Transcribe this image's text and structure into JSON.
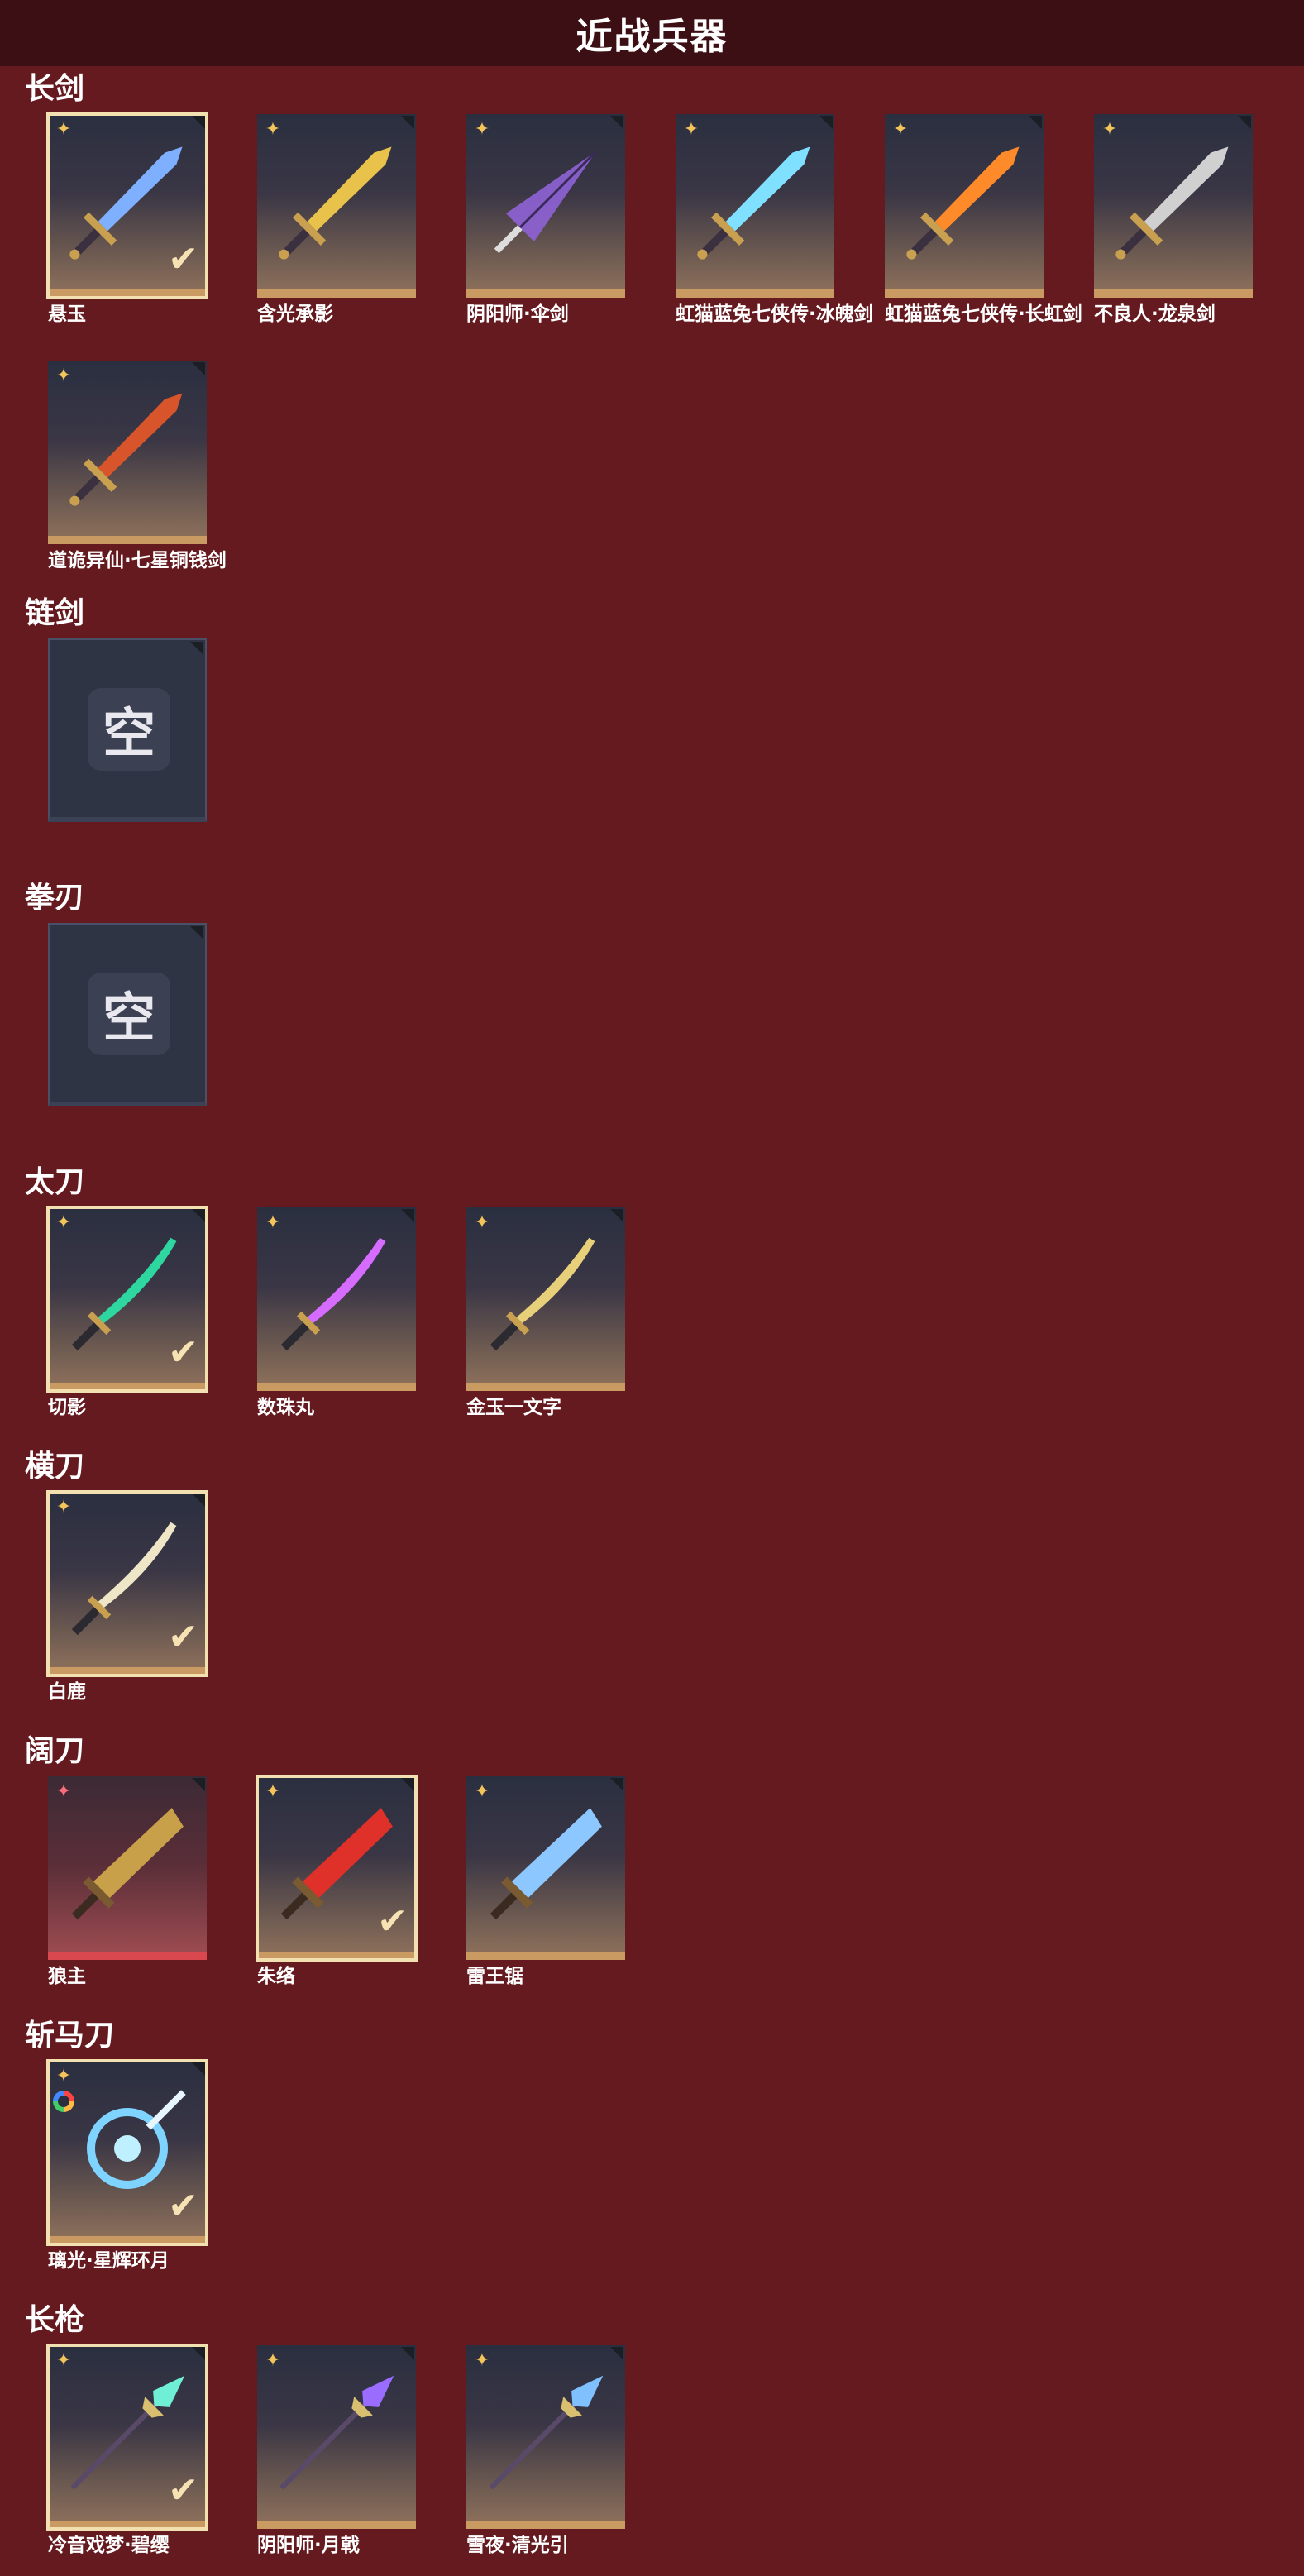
{
  "title": "近战兵器",
  "empty_text": "空",
  "sections": [
    {
      "title": "长剑",
      "items": [
        {
          "name": "悬玉",
          "rarity": "gold",
          "selected": true,
          "color": "#7fb0ff",
          "style": "sword"
        },
        {
          "name": "含光承影",
          "rarity": "gold",
          "selected": false,
          "color": "#e8c24a",
          "style": "sword"
        },
        {
          "name": "阴阳师·伞剑",
          "rarity": "gold",
          "selected": false,
          "color": "#8f63d6",
          "style": "umbrella"
        },
        {
          "name": "虹猫蓝兔七侠传·冰魄剑",
          "rarity": "gold",
          "selected": false,
          "color": "#7fe0ff",
          "style": "sword"
        },
        {
          "name": "虹猫蓝兔七侠传·长虹剑",
          "rarity": "gold",
          "selected": false,
          "color": "#ff8a2a",
          "style": "sword"
        },
        {
          "name": "不良人·龙泉剑",
          "rarity": "gold",
          "selected": false,
          "color": "#d0d0d0",
          "style": "sword"
        },
        {
          "name": "道诡异仙·七星铜钱剑",
          "rarity": "gold",
          "selected": false,
          "color": "#d8552c",
          "style": "sword"
        }
      ]
    },
    {
      "title": "链剑",
      "items": [
        {
          "empty": true
        }
      ]
    },
    {
      "title": "拳刃",
      "items": [
        {
          "empty": true
        }
      ]
    },
    {
      "title": "太刀",
      "items": [
        {
          "name": "切影",
          "rarity": "gold",
          "selected": true,
          "color": "#2ed6a0",
          "style": "blade"
        },
        {
          "name": "数珠丸",
          "rarity": "gold",
          "selected": false,
          "color": "#d56bff",
          "style": "blade"
        },
        {
          "name": "金玉一文字",
          "rarity": "gold",
          "selected": false,
          "color": "#e8d07a",
          "style": "blade"
        }
      ]
    },
    {
      "title": "横刀",
      "items": [
        {
          "name": "白鹿",
          "rarity": "gold",
          "selected": true,
          "color": "#efe6c8",
          "style": "blade"
        }
      ]
    },
    {
      "title": "阔刀",
      "items": [
        {
          "name": "狼主",
          "rarity": "pink",
          "selected": false,
          "color": "#c9a04a",
          "style": "broad",
          "red": true
        },
        {
          "name": "朱络",
          "rarity": "gold",
          "selected": true,
          "color": "#e0302a",
          "style": "broad"
        },
        {
          "name": "雷王锯",
          "rarity": "gold",
          "selected": false,
          "color": "#8cc8ff",
          "style": "broad"
        }
      ]
    },
    {
      "title": "斩马刀",
      "items": [
        {
          "name": "璃光·星辉环月",
          "rarity": "gold",
          "selected": true,
          "color": "#7fd4ff",
          "style": "moon",
          "ring": true
        }
      ]
    },
    {
      "title": "长枪",
      "items": [
        {
          "name": "冷音戏梦·碧缨",
          "rarity": "gold",
          "selected": true,
          "color": "#6ff0d6",
          "style": "spear"
        },
        {
          "name": "阴阳师·月戟",
          "rarity": "gold",
          "selected": false,
          "color": "#9a6cff",
          "style": "spear"
        },
        {
          "name": "雪夜·清光引",
          "rarity": "gold",
          "selected": false,
          "color": "#7fc0ff",
          "style": "spear"
        }
      ]
    }
  ]
}
